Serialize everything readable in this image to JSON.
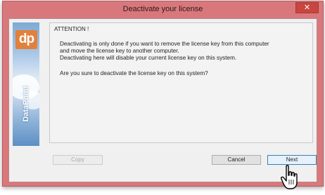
{
  "window": {
    "title": "Deactivate your license",
    "close_label": "✕"
  },
  "logo": {
    "badge": "dp",
    "text": "DataPoint"
  },
  "message": {
    "heading": "ATTENTION !",
    "lines": [
      "Deactivating is only done if you want to remove the license key from this computer",
      "and move the license key to another computer.",
      "Deactivating here will disable your current license key on this system."
    ],
    "question": "Are you sure to deactivate the license key on this system?"
  },
  "buttons": {
    "copy": "Copy",
    "cancel": "Cancel",
    "next": "Next"
  },
  "icons": {
    "cursor": "hand-pointer-icon"
  }
}
